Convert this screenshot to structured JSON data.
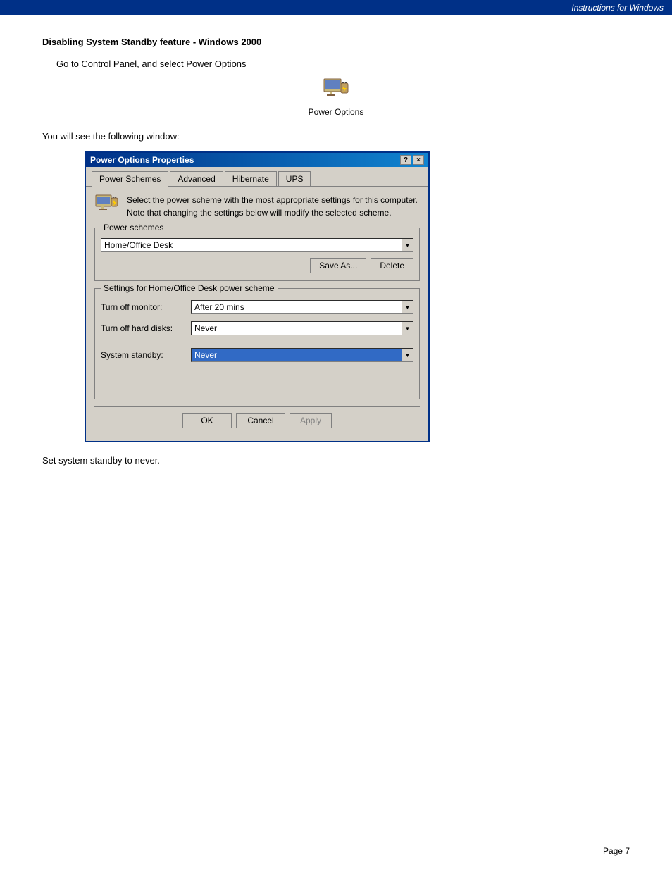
{
  "header": {
    "text": "Instructions for Windows"
  },
  "main": {
    "title": "Disabling System Standby feature  - Windows 2000",
    "instruction": "Go to Control Panel, and select  Power Options",
    "power_options_label": "Power Options",
    "following_text": "You will see the following window:",
    "bottom_text": "Set system standby to never.",
    "page_number": "Page 7"
  },
  "dialog": {
    "title": "Power Options Properties",
    "titlebar_help": "?",
    "titlebar_close": "×",
    "tabs": [
      {
        "label": "Power Schemes",
        "active": true
      },
      {
        "label": "Advanced",
        "active": false
      },
      {
        "label": "Hibernate",
        "active": false
      },
      {
        "label": "UPS",
        "active": false
      }
    ],
    "info_text": "Select the power scheme with the most appropriate settings for this computer. Note that changing the settings below will modify the selected scheme.",
    "power_schemes_legend": "Power schemes",
    "scheme_value": "Home/Office Desk",
    "save_as_label": "Save As...",
    "delete_label": "Delete",
    "settings_legend": "Settings for Home/Office Desk power scheme",
    "settings": [
      {
        "label": "Turn off monitor:",
        "value": "After 20 mins"
      },
      {
        "label": "Turn off hard disks:",
        "value": "Never"
      },
      {
        "label": "System standby:",
        "value": "Never",
        "highlighted": true
      }
    ],
    "ok_label": "OK",
    "cancel_label": "Cancel",
    "apply_label": "Apply"
  }
}
